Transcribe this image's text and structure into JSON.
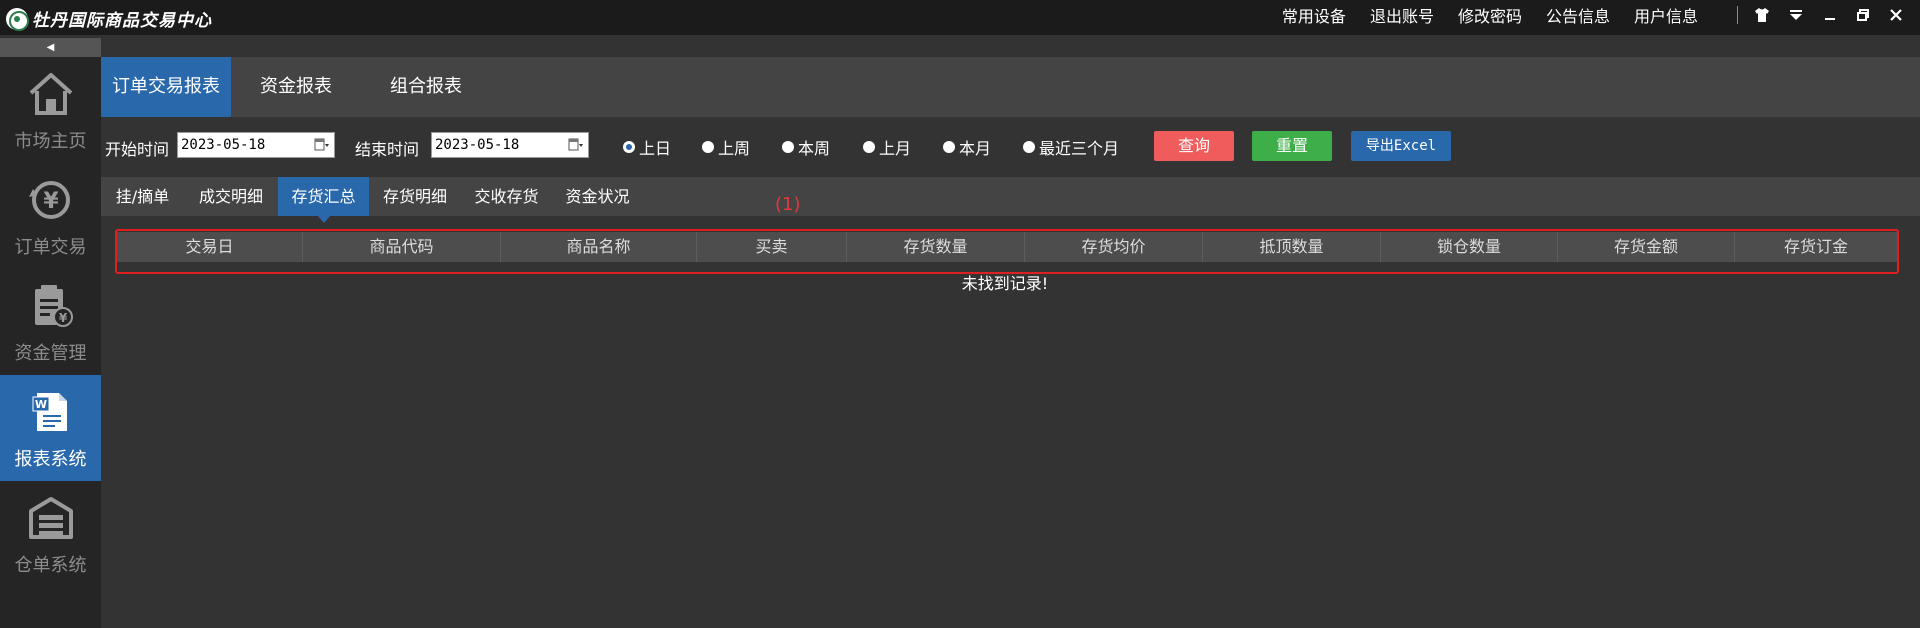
{
  "app": {
    "title": "牡丹国际商品交易中心"
  },
  "top_menu": {
    "items": [
      "常用设备",
      "退出账号",
      "修改密码",
      "公告信息",
      "用户信息"
    ]
  },
  "sidebar": {
    "items": [
      {
        "label": "市场主页",
        "icon": "home-icon"
      },
      {
        "label": "订单交易",
        "icon": "yen-coin-icon"
      },
      {
        "label": "资金管理",
        "icon": "clipboard-yen-icon"
      },
      {
        "label": "报表系统",
        "icon": "word-document-icon",
        "active": true
      },
      {
        "label": "仓单系统",
        "icon": "warehouse-icon"
      }
    ]
  },
  "report_tabs": {
    "items": [
      "订单交易报表",
      "资金报表",
      "组合报表"
    ],
    "active": "订单交易报表"
  },
  "filter": {
    "start_label": "开始时间",
    "start_value": "2023-05-18",
    "end_label": "结束时间",
    "end_value": "2023-05-18",
    "ranges": [
      "上日",
      "上周",
      "本周",
      "上月",
      "本月",
      "最近三个月"
    ],
    "selected_range": "上日",
    "query_label": "查询",
    "reset_label": "重置",
    "export_label": "导出Excel"
  },
  "sub_tabs": {
    "items": [
      "挂/摘单",
      "成交明细",
      "存货汇总",
      "存货明细",
      "交收存货",
      "资金状况"
    ],
    "active": "存货汇总"
  },
  "annotation": {
    "label": "(1)"
  },
  "table": {
    "columns": [
      "交易日",
      "商品代码",
      "商品名称",
      "买卖",
      "存货数量",
      "存货均价",
      "抵顶数量",
      "锁仓数量",
      "存货金额",
      "存货订金"
    ],
    "rows": [],
    "empty_message": "未找到记录!"
  },
  "colors": {
    "accent": "#2a68ac",
    "query_button": "#f05b5b",
    "reset_button": "#3eae49",
    "annotation": "#e02020"
  }
}
